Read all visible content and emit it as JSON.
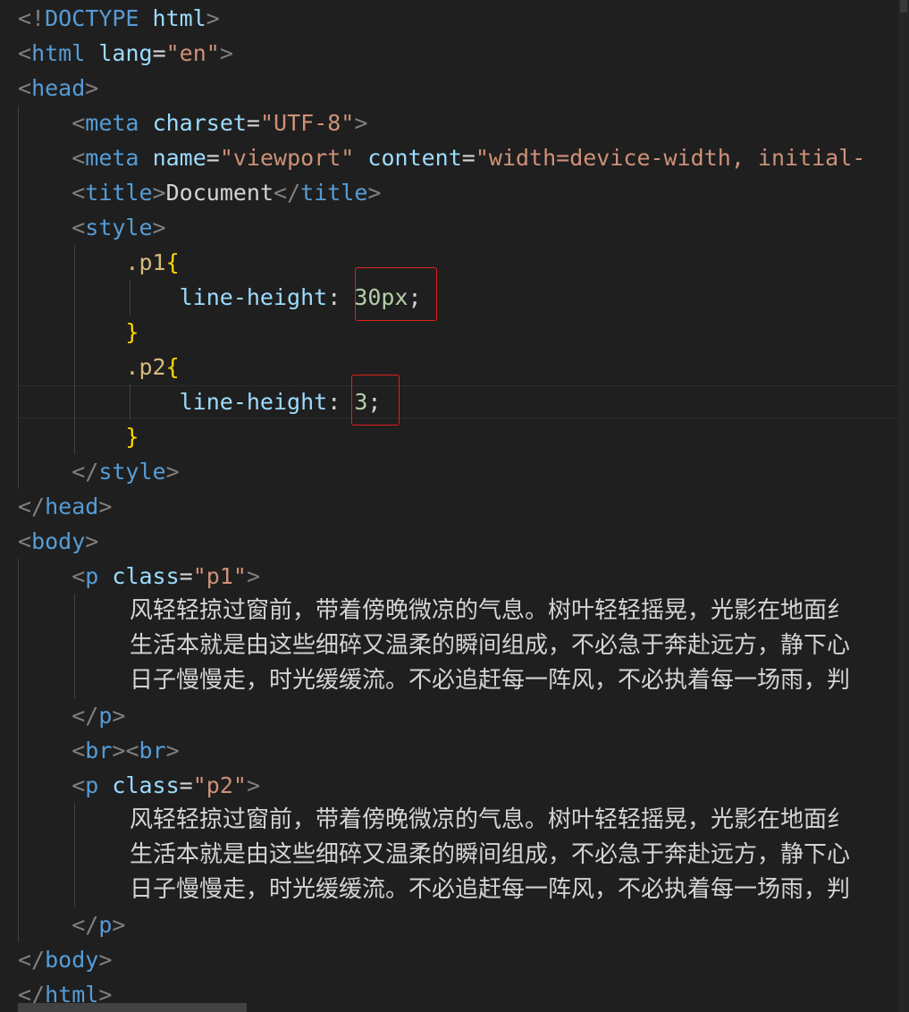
{
  "code": {
    "l1_open": "<!",
    "l1_doctype": "DOCTYPE",
    "l1_html": " html",
    "l1_close": ">",
    "html_tag": "html",
    "html_attr": "lang",
    "html_val": "\"en\"",
    "head_tag": "head",
    "meta_tag": "meta",
    "meta1_attr": "charset",
    "meta1_val": "\"UTF-8\"",
    "meta2_attr1": "name",
    "meta2_val1": "\"viewport\"",
    "meta2_attr2": "content",
    "meta2_val2": "\"width=device-width, initial-",
    "title_tag": "title",
    "title_text": "Document",
    "style_tag": "style",
    "sel_p1": ".p1",
    "sel_p2": ".p2",
    "open_brace": "{",
    "close_brace": "}",
    "prop": "line-height",
    "colon": ":",
    "p1_value": "30px",
    "p2_value": "3",
    "semicolon": ";",
    "body_tag": "body",
    "p_tag": "p",
    "class_attr": "class",
    "p1_class": "\"p1\"",
    "p2_class": "\"p2\"",
    "br_tag": "br",
    "eq": "=",
    "lt": "<",
    "gt": ">",
    "lt_slash": "</"
  },
  "paragraph_lines": [
    "风轻轻掠过窗前，带着傍晚微凉的气息。树叶轻轻摇晃，光影在地面纟",
    "生活本就是由这些细碎又温柔的瞬间组成，不必急于奔赴远方，静下心",
    "日子慢慢走，时光缓缓流。不必追赶每一阵风，不必执着每一场雨，判"
  ],
  "colors": {
    "background": "#1f1f1f",
    "bracket": "#808080",
    "tag": "#569cd6",
    "attribute": "#9cdcfe",
    "string": "#ce9178",
    "selector": "#d7ba7d",
    "number": "#b5cea8",
    "brace": "#ffd700",
    "highlight_box": "#e0201b"
  }
}
